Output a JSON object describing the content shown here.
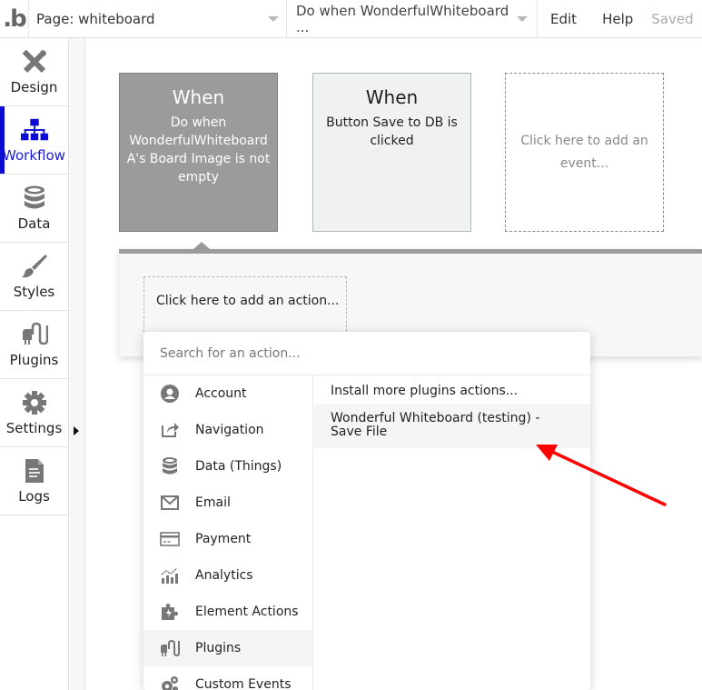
{
  "topbar": {
    "logo": ".b",
    "page_select": "Page: whiteboard",
    "workflow_select": "Do when WonderfulWhiteboard ...",
    "menu": [
      "Edit",
      "Help"
    ],
    "status": "Saved"
  },
  "sidebar": {
    "items": [
      {
        "label": "Design",
        "icon": "design-icon"
      },
      {
        "label": "Workflow",
        "icon": "workflow-icon",
        "active": true
      },
      {
        "label": "Data",
        "icon": "database-icon"
      },
      {
        "label": "Styles",
        "icon": "brush-icon"
      },
      {
        "label": "Plugins",
        "icon": "plug-icon"
      },
      {
        "label": "Settings",
        "icon": "gear-icon"
      },
      {
        "label": "Logs",
        "icon": "document-icon"
      }
    ]
  },
  "events": [
    {
      "title": "When",
      "description": "Do when WonderfulWhiteboard A's Board Image is not empty",
      "selected": true
    },
    {
      "title": "When",
      "description": "Button Save to DB is clicked"
    },
    {
      "description": "Click here to add an event..."
    }
  ],
  "action_panel": {
    "add_action": "Click here to add an action..."
  },
  "action_dropdown": {
    "search_placeholder": "Search for an action...",
    "search_value": "",
    "categories": [
      {
        "label": "Account",
        "icon": "user-circle-icon"
      },
      {
        "label": "Navigation",
        "icon": "share-icon"
      },
      {
        "label": "Data (Things)",
        "icon": "database-icon"
      },
      {
        "label": "Email",
        "icon": "envelope-icon"
      },
      {
        "label": "Payment",
        "icon": "credit-card-icon"
      },
      {
        "label": "Analytics",
        "icon": "analytics-icon"
      },
      {
        "label": "Element Actions",
        "icon": "puzzle-bolt-icon"
      },
      {
        "label": "Plugins",
        "icon": "plug-icon",
        "selected": true
      },
      {
        "label": "Custom Events",
        "icon": "gears-icon"
      }
    ],
    "subitems": [
      {
        "label": "Install more plugins actions..."
      },
      {
        "label": "Wonderful Whiteboard (testing) - Save File",
        "highlighted": true
      }
    ]
  },
  "annotation": {
    "type": "arrow",
    "color": "#ff0000"
  }
}
